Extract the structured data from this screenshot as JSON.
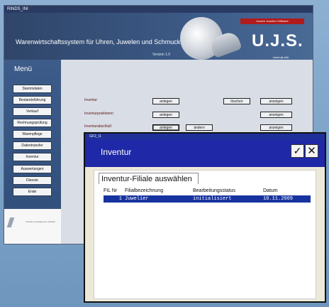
{
  "app": {
    "window_title": "RINDS_INI",
    "title": "Warenwirtschaftssystem für Uhren, Juwelen und Schmuck",
    "version": "Version 1.0"
  },
  "brand": {
    "banner": "Unsere Juwelen Software",
    "logo": "U.J.S.",
    "url": "www.ujs.info"
  },
  "sidebar": {
    "menu_title": "Menü",
    "items": [
      {
        "label": "Stammdaten"
      },
      {
        "label": "Bestandsführung"
      },
      {
        "label": "Verkauf"
      },
      {
        "label": "Rechnungsprüfung"
      },
      {
        "label": "Warenpflege"
      },
      {
        "label": "Datentransfer"
      },
      {
        "label": "Inventur"
      },
      {
        "label": "Auswertungen"
      },
      {
        "label": "Dienste"
      },
      {
        "label": "Ende"
      }
    ],
    "logo_text": "trotzdem management software"
  },
  "main": {
    "rows": [
      {
        "label": "Inventur",
        "anlegen": "anlegen",
        "loeschen": "löschen",
        "anzeigen": "anzeigen"
      },
      {
        "label": "Inventurpositionen",
        "anlegen": "anlegen",
        "anzeigen": "anzeigen"
      },
      {
        "label": "Inventurabschluß",
        "anlegen": "anlegen",
        "aendern": "ändern",
        "anzeigen": "anzeigen"
      }
    ]
  },
  "dialog": {
    "window_title": "GF2_I1",
    "heading": "Inventur",
    "check": "✓",
    "close": "✕",
    "tab_label": "Inventur-Filiale auswählen",
    "columns": {
      "fil_nr": "FIL Nr",
      "filiale": "Filialbezeichnung",
      "status": "Bearbeitungsstatus",
      "datum": "Datum"
    },
    "rows": [
      {
        "fil_nr": "1",
        "filiale": "Juwelier",
        "status": "initialisiert",
        "datum": "10.11.2009"
      }
    ]
  }
}
